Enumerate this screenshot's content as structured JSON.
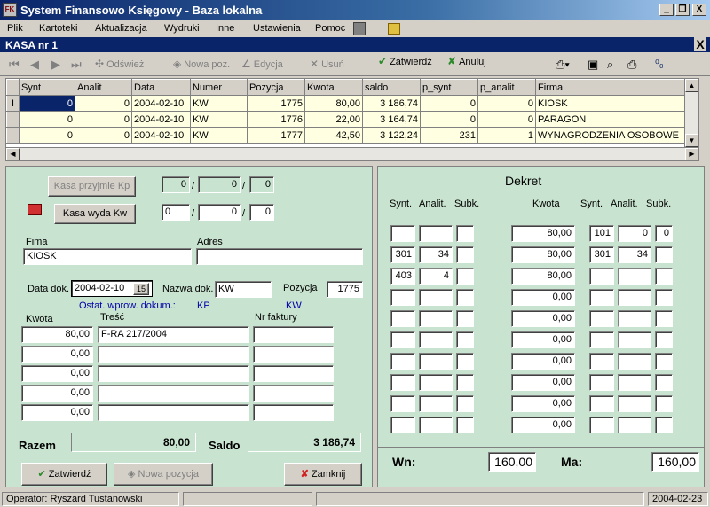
{
  "window": {
    "title": "System Finansowo Księgowy - Baza lokalna",
    "logo_text": "FK",
    "minimize": "_",
    "restore": "❐",
    "close": "X"
  },
  "menu": {
    "items": [
      "Plik",
      "Kartoteki",
      "Aktualizacja",
      "Wydruki",
      "Inne",
      "Ustawienia",
      "Pomoc"
    ]
  },
  "child_window": {
    "title": "KASA nr 1",
    "close": "X"
  },
  "toolbar": {
    "refresh": "Odśwież",
    "new_item": "Nowa poz.",
    "edit": "Edycja",
    "delete": "Usuń",
    "confirm": "Zatwierdź",
    "cancel": "Anuluj"
  },
  "grid": {
    "columns": [
      "Synt",
      "Analit",
      "Data",
      "Numer",
      "Pozycja",
      "Kwota",
      "saldo",
      "p_synt",
      "p_analit",
      "Firma"
    ],
    "rows": [
      [
        "0",
        "0",
        "2004-02-10",
        "KW",
        "1775",
        "80,00",
        "3 186,74",
        "0",
        "0",
        "KIOSK"
      ],
      [
        "0",
        "0",
        "2004-02-10",
        "KW",
        "1776",
        "22,00",
        "3 164,74",
        "0",
        "0",
        "PARAGON"
      ],
      [
        "0",
        "0",
        "2004-02-10",
        "KW",
        "1777",
        "42,50",
        "3 122,24",
        "231",
        "1",
        "WYNAGRODZENIA OSOBOWE"
      ]
    ],
    "indicator": "I"
  },
  "form": {
    "kasa_przyjmie": "Kasa przyjmie  Kp",
    "kasa_wyda": "Kasa wyda  Kw",
    "kp_fields": [
      "0",
      "0",
      "0"
    ],
    "kw_fields": [
      "0",
      "0",
      "0"
    ],
    "slash": "/",
    "firma_label": "Fima",
    "firma_value": "KIOSK",
    "adres_label": "Adres",
    "adres_value": "",
    "data_dok_label": "Data dok.",
    "data_dok_value": "2004-02-10",
    "calendar_icon": "15",
    "nazwa_dok_label": "Nazwa dok.",
    "nazwa_dok_value": "KW",
    "pozycja_label": "Pozycja",
    "pozycja_value": "1775",
    "ostat_label": "Ostat. wprow. dokum.:",
    "ostat_kp": "KP",
    "ostat_kw": "KW",
    "kwota_label": "Kwota",
    "tresc_label": "Treść",
    "nr_faktury_label": "Nr faktury",
    "lines": [
      {
        "kwota": "80,00",
        "tresc": "F-RA 217/2004",
        "nr": ""
      },
      {
        "kwota": "0,00",
        "tresc": "",
        "nr": ""
      },
      {
        "kwota": "0,00",
        "tresc": "",
        "nr": ""
      },
      {
        "kwota": "0,00",
        "tresc": "",
        "nr": ""
      },
      {
        "kwota": "0,00",
        "tresc": "",
        "nr": ""
      }
    ],
    "razem_label": "Razem",
    "razem_value": "80,00",
    "saldo_label": "Saldo",
    "saldo_value": "3 186,74",
    "btn_confirm": "Zatwierdź",
    "btn_new": "Nowa pozycja",
    "btn_close": "Zamknij"
  },
  "dekret": {
    "title": "Dekret",
    "headers_left": [
      "Synt.",
      "Analit.",
      "Subk."
    ],
    "header_kwota": "Kwota",
    "headers_right": [
      "Synt.",
      "Analit.",
      "Subk."
    ],
    "rows": [
      {
        "ls": "",
        "la": "",
        "lk": "",
        "kw": "80,00",
        "rs": "101",
        "ra": "0",
        "rk": "0"
      },
      {
        "ls": "301",
        "la": "34",
        "lk": "",
        "kw": "80,00",
        "rs": "301",
        "ra": "34",
        "rk": ""
      },
      {
        "ls": "403",
        "la": "4",
        "lk": "",
        "kw": "80,00",
        "rs": "",
        "ra": "",
        "rk": ""
      },
      {
        "ls": "",
        "la": "",
        "lk": "",
        "kw": "0,00",
        "rs": "",
        "ra": "",
        "rk": ""
      },
      {
        "ls": "",
        "la": "",
        "lk": "",
        "kw": "0,00",
        "rs": "",
        "ra": "",
        "rk": ""
      },
      {
        "ls": "",
        "la": "",
        "lk": "",
        "kw": "0,00",
        "rs": "",
        "ra": "",
        "rk": ""
      },
      {
        "ls": "",
        "la": "",
        "lk": "",
        "kw": "0,00",
        "rs": "",
        "ra": "",
        "rk": ""
      },
      {
        "ls": "",
        "la": "",
        "lk": "",
        "kw": "0,00",
        "rs": "",
        "ra": "",
        "rk": ""
      },
      {
        "ls": "",
        "la": "",
        "lk": "",
        "kw": "0,00",
        "rs": "",
        "ra": "",
        "rk": ""
      },
      {
        "ls": "",
        "la": "",
        "lk": "",
        "kw": "0,00",
        "rs": "",
        "ra": "",
        "rk": ""
      }
    ],
    "wn_label": "Wn:",
    "wn_value": "160,00",
    "ma_label": "Ma:",
    "ma_value": "160,00"
  },
  "status": {
    "operator": "Operator: Ryszard Tustanowski",
    "date": "2004-02-23"
  }
}
